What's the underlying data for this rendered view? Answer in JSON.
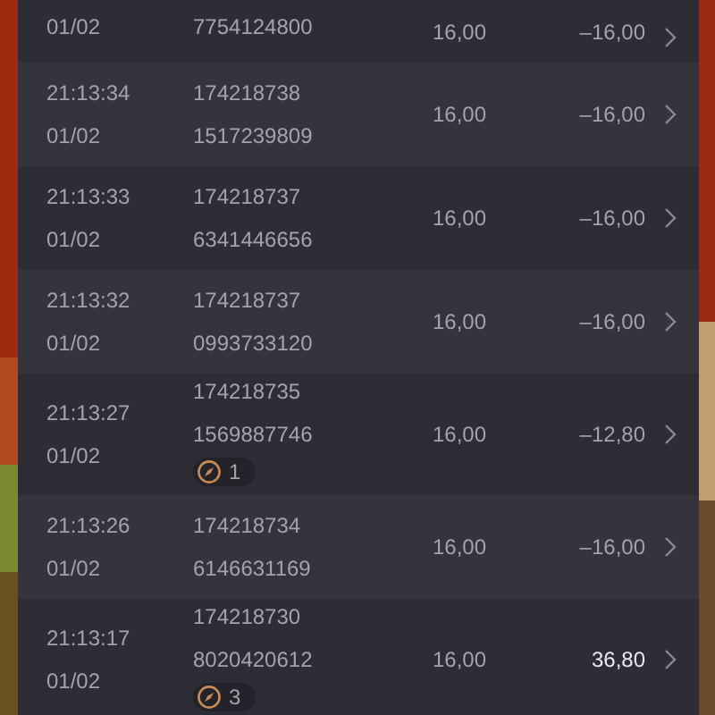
{
  "rows": [
    {
      "time": "",
      "date": "01/02",
      "order": "",
      "ref": "7754124800",
      "price": "16,00",
      "net": "–16,00",
      "positive": false
    },
    {
      "time": "21:13:34",
      "date": "01/02",
      "order": "174218738",
      "ref": "1517239809",
      "price": "16,00",
      "net": "–16,00",
      "positive": false
    },
    {
      "time": "21:13:33",
      "date": "01/02",
      "order": "174218737",
      "ref": "6341446656",
      "price": "16,00",
      "net": "–16,00",
      "positive": false
    },
    {
      "time": "21:13:32",
      "date": "01/02",
      "order": "174218737",
      "ref": "0993733120",
      "price": "16,00",
      "net": "–16,00",
      "positive": false
    },
    {
      "time": "21:13:27",
      "date": "01/02",
      "order": "174218735",
      "ref": "1569887746",
      "badge": "1",
      "price": "16,00",
      "net": "–12,80",
      "positive": false
    },
    {
      "time": "21:13:26",
      "date": "01/02",
      "order": "174218734",
      "ref": "6146631169",
      "price": "16,00",
      "net": "–16,00",
      "positive": false
    },
    {
      "time": "21:13:17",
      "date": "01/02",
      "order": "174218730",
      "ref": "8020420612",
      "badge": "3",
      "price": "16,00",
      "net": "36,80",
      "positive": true
    }
  ]
}
